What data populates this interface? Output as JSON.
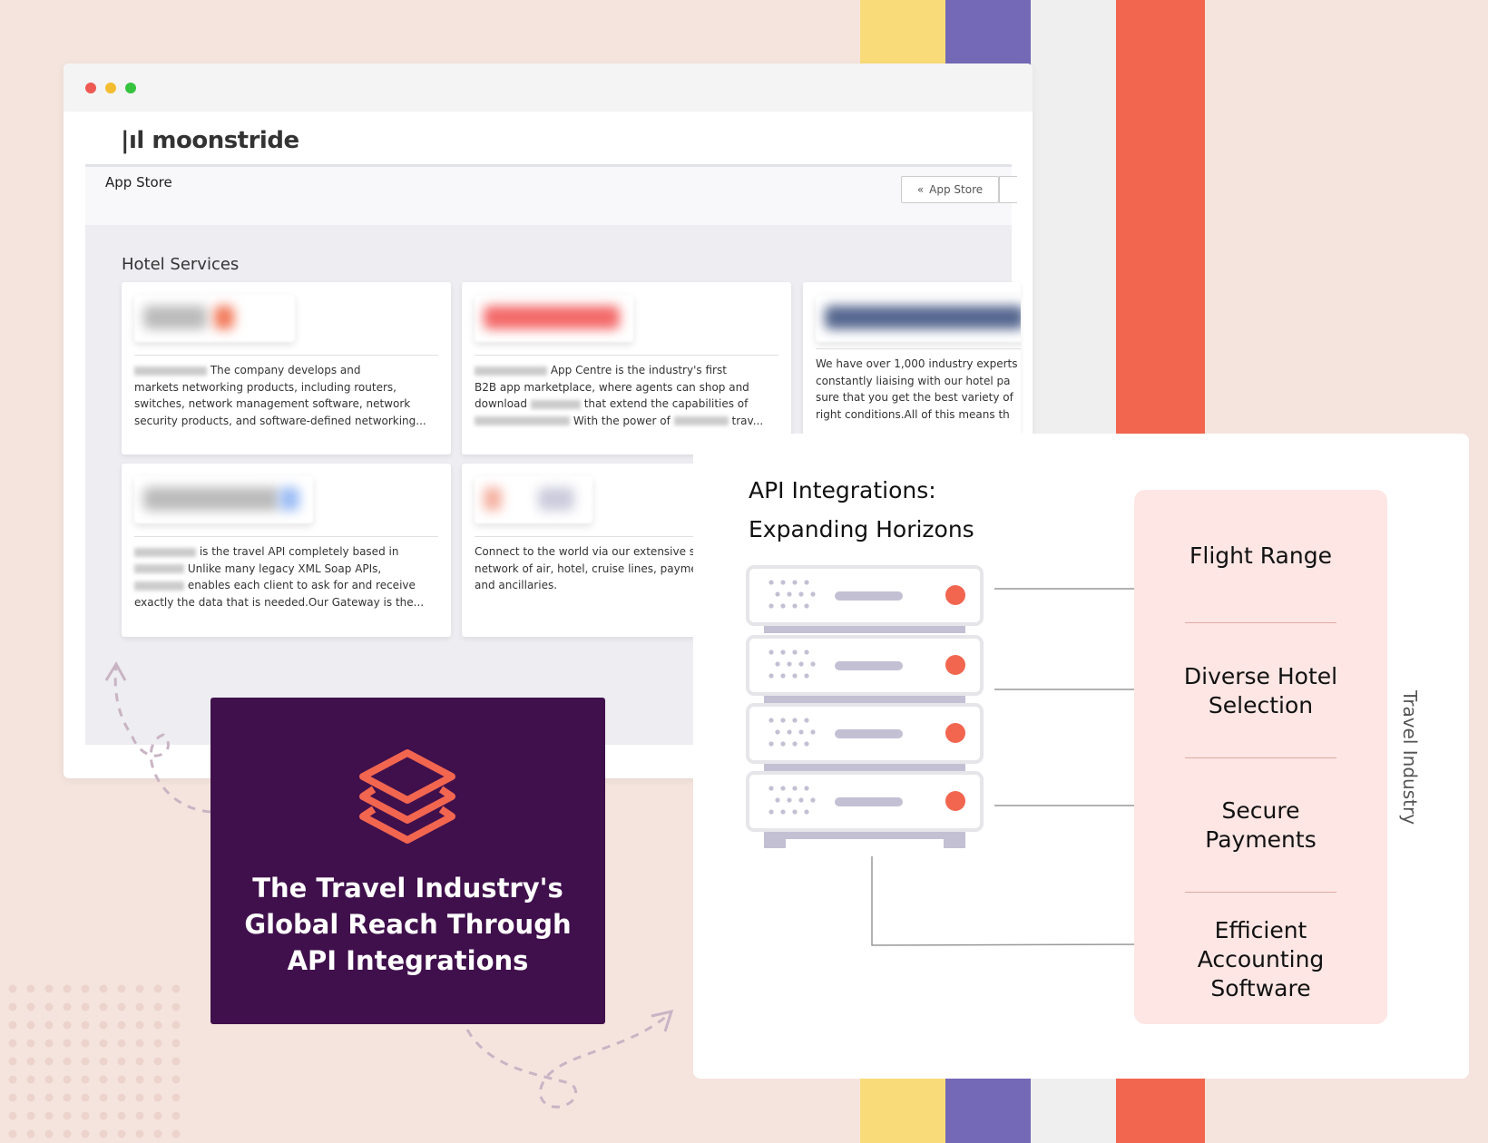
{
  "colors": {
    "background": "#f5e4de",
    "stripes": [
      "#f9dc79",
      "#7469b6",
      "#efefef",
      "#f26650"
    ],
    "brand_purple": "#40104c",
    "accent": "#f26650",
    "pink": "#fde6e4"
  },
  "window": {
    "logo_text": "moonstride",
    "app_bar_title": "App Store",
    "back_button": {
      "label": "App Store",
      "icon": "double-chevron-left-icon"
    },
    "section_title": "Hotel Services",
    "cards": [
      {
        "text_lines": [
          "The company develops and",
          "markets networking products, including routers,",
          "switches, network management software, network",
          "security products, and software-defined networking..."
        ]
      },
      {
        "text_lines": [
          "App Centre is the industry's first",
          "B2B app marketplace, where agents can shop and",
          "download",
          "that extend the capabilities of",
          "With the power of",
          "trav..."
        ]
      },
      {
        "text_lines": [
          "We have over 1,000 industry experts",
          "constantly liaising with our hotel pa",
          "sure that you get the best variety of",
          "right conditions.All of this means th"
        ]
      },
      {
        "text_lines": [
          "is the travel API completely based in",
          "Unlike many legacy XML Soap APIs,",
          "enables each client to ask for and receive",
          "exactly the data that is needed.Our Gateway is the..."
        ]
      },
      {
        "text_lines": [
          "Connect to the world via our extensive s",
          "network of air, hotel, cruise lines, payme",
          "and ancillaries."
        ]
      }
    ]
  },
  "promo": {
    "icon": "layers-icon",
    "title_lines": [
      "The Travel Industry's",
      "Global Reach Through",
      "API Integrations"
    ]
  },
  "diagram": {
    "title_lines": [
      "API Integrations:",
      "Expanding Horizons"
    ],
    "side_label": "Travel Industry",
    "items": [
      {
        "lines": [
          "Flight Range"
        ]
      },
      {
        "lines": [
          "Diverse Hotel",
          "Selection"
        ]
      },
      {
        "lines": [
          "Secure",
          "Payments"
        ]
      },
      {
        "lines": [
          "Efficient",
          "Accounting",
          "Software"
        ]
      }
    ]
  }
}
